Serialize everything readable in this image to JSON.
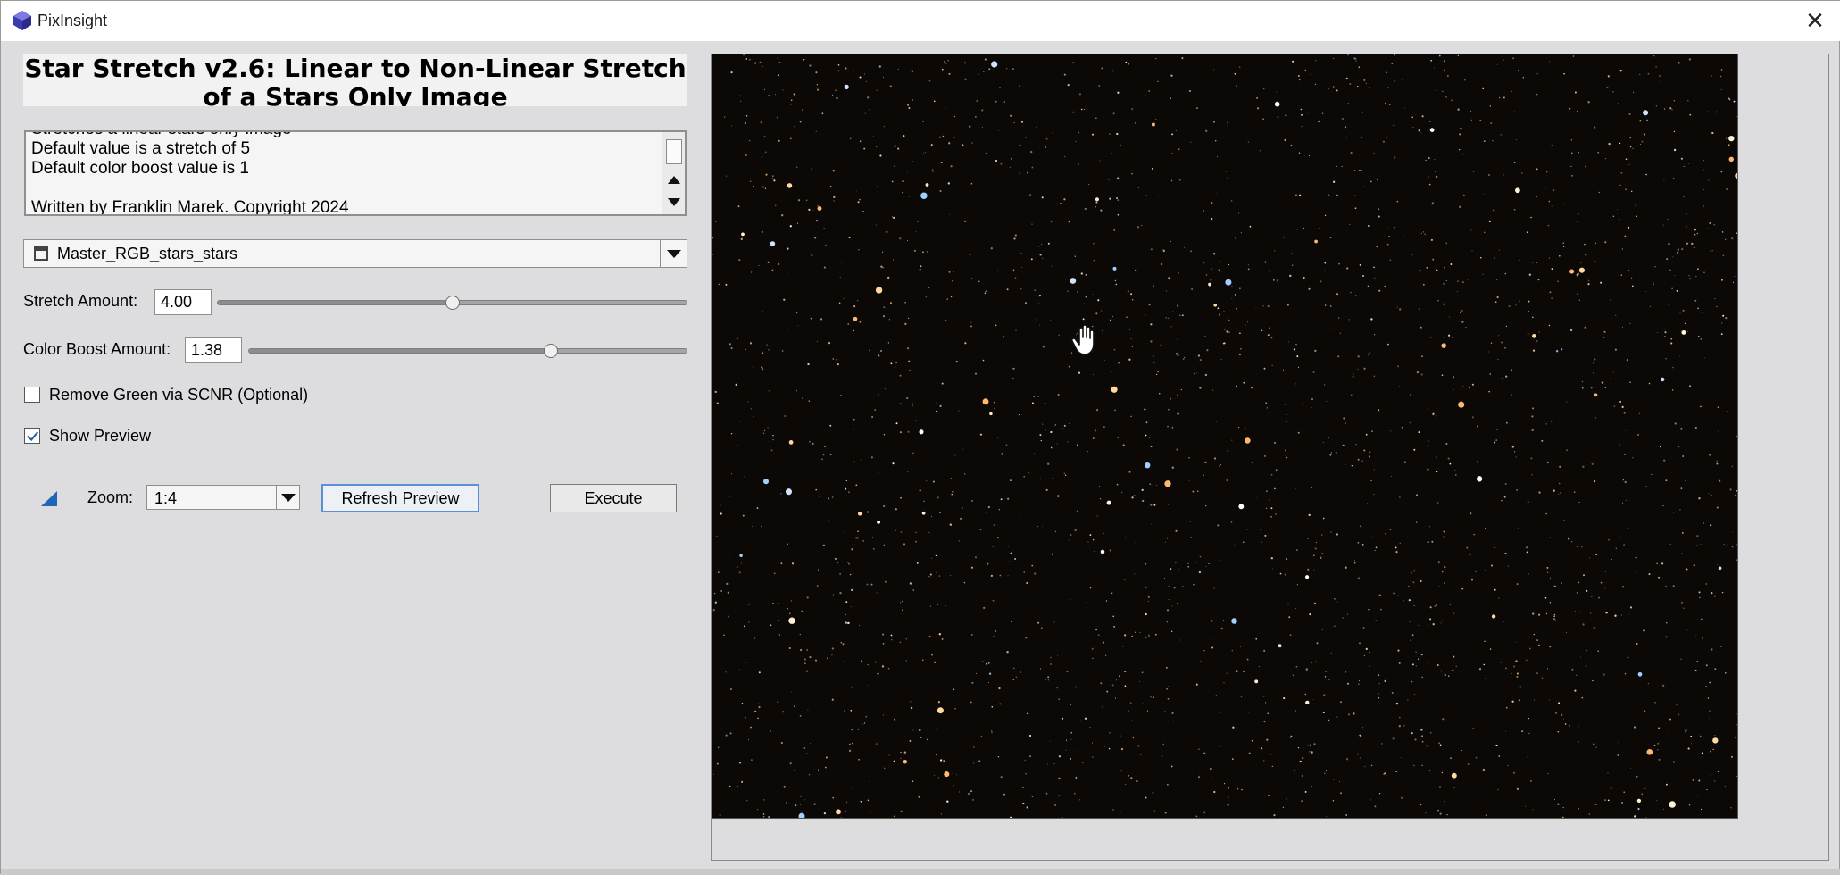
{
  "window": {
    "title": "PixInsight",
    "close_glyph": "✕"
  },
  "header": {
    "title_line1": "Star Stretch v2.6: Linear to Non-Linear Stretch",
    "title_line2": "of a Stars Only Image"
  },
  "info": {
    "lines": [
      "Stretches a linear stars only image",
      "Default value is a stretch of 5",
      "Default color boost value is 1",
      "",
      "Written by Franklin Marek. Copyright 2024"
    ]
  },
  "view_selector": {
    "icon": "image-view-icon",
    "selected": "Master_RGB_stars_stars"
  },
  "stretch": {
    "label": "Stretch Amount:",
    "value": "4.00",
    "fraction": 0.5
  },
  "color_boost": {
    "label": "Color Boost Amount:",
    "value": "1.38",
    "fraction": 0.69
  },
  "scnr": {
    "label": "Remove Green via SCNR (Optional)",
    "checked": false
  },
  "show_preview": {
    "label": "Show Preview",
    "checked": true
  },
  "zoom": {
    "label": "Zoom:",
    "selected": "1:4"
  },
  "buttons": {
    "refresh": "Refresh Preview",
    "execute": "Execute"
  },
  "colors": {
    "accent": "#1f66b8",
    "preview_bg": "#0b0806"
  }
}
